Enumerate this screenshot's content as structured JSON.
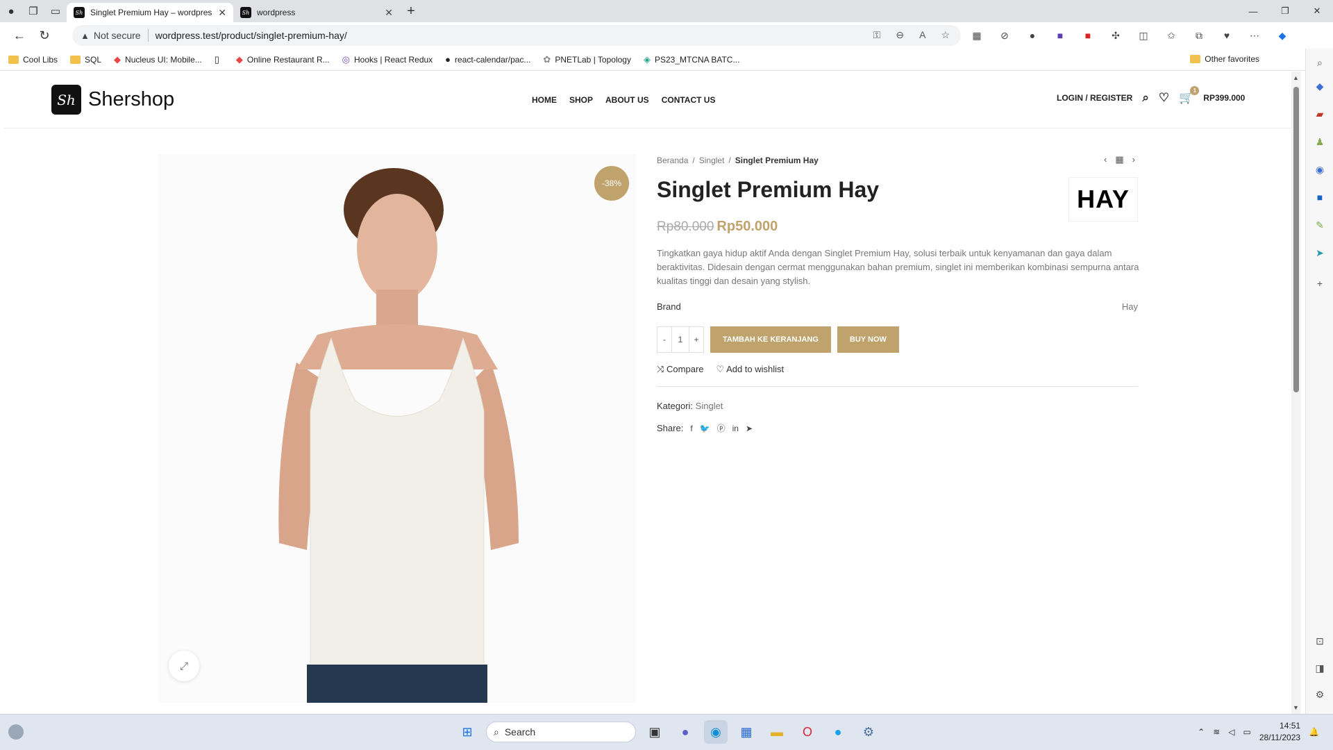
{
  "browser": {
    "tabs": [
      {
        "title": "Singlet Premium Hay – wordpress",
        "fav": "Sh"
      },
      {
        "title": "wordpress",
        "fav": "Sh"
      }
    ],
    "security": "Not secure",
    "url": "wordpress.test/product/singlet-premium-hay/",
    "bookmarks": [
      "Cool Libs",
      "SQL",
      "Nucleus UI: Mobile...",
      "",
      "Online Restaurant R...",
      "Hooks | React Redux",
      "react-calendar/pac...",
      "PNETLab | Topology",
      "PS23_MTCNA BATC..."
    ],
    "other_favorites": "Other favorites"
  },
  "site": {
    "logo_mark": "Sh",
    "logo_text": "Shershop",
    "nav": [
      "HOME",
      "SHOP",
      "ABOUT US",
      "CONTACT US"
    ],
    "login": "LOGIN / REGISTER",
    "cart_count": "1",
    "cart_total": "RP399.000"
  },
  "product": {
    "badge": "-38%",
    "breadcrumb": [
      "Beranda",
      "Singlet",
      "Singlet Premium Hay"
    ],
    "title": "Singlet Premium Hay",
    "brand_logo": "HAY",
    "old_price": "Rp80.000",
    "new_price": "Rp50.000",
    "description": "Tingkatkan gaya hidup aktif Anda dengan Singlet Premium Hay, solusi terbaik untuk kenyamanan dan gaya dalam beraktivitas. Didesain dengan cermat menggunakan bahan premium, singlet ini memberikan kombinasi sempurna antara kualitas tinggi dan desain yang stylish.",
    "brand_label": "Brand",
    "brand_value": "Hay",
    "qty": "1",
    "qty_minus": "-",
    "qty_plus": "+",
    "add_to_cart": "TAMBAH KE KERANJANG",
    "buy_now": "BUY NOW",
    "compare": "Compare",
    "wishlist": "Add to wishlist",
    "kategori_label": "Kategori:",
    "kategori_value": "Singlet",
    "share_label": "Share:",
    "share_icons": [
      "facebook-icon",
      "twitter-icon",
      "pinterest-icon",
      "linkedin-icon",
      "telegram-icon"
    ]
  },
  "taskbar": {
    "search": "Search",
    "time": "14:51",
    "date": "28/11/2023"
  },
  "colors": {
    "accent": "#bfa26c",
    "dark": "#111111"
  }
}
